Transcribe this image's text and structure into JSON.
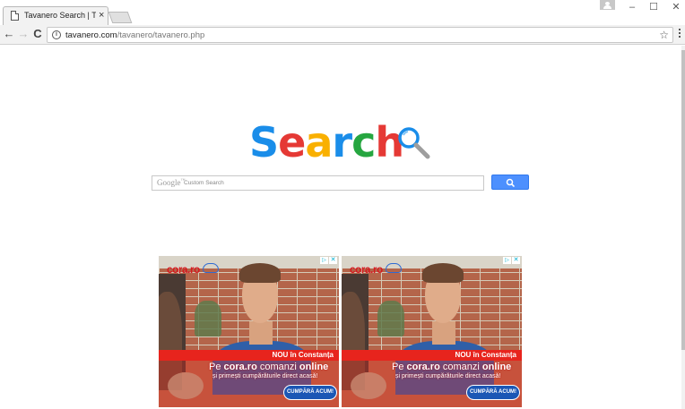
{
  "browser": {
    "tab_title": "Tavanero Search | Tavane",
    "tab_close": "×",
    "url_host": "tavanero.com",
    "url_path": "/tavanero/tavanero.php",
    "window_minimize": "–",
    "window_maximize": "☐",
    "window_close": "✕",
    "nav_back": "←",
    "nav_forward": "→",
    "nav_reload": "C",
    "info_glyph": "i",
    "star_glyph": "☆"
  },
  "logo": {
    "letters": [
      {
        "char": "S",
        "color": "#1a8de9"
      },
      {
        "char": "e",
        "color": "#e53935"
      },
      {
        "char": "a",
        "color": "#f9b000"
      },
      {
        "char": "r",
        "color": "#1a8de9"
      },
      {
        "char": "c",
        "color": "#26a640"
      },
      {
        "char": "h",
        "color": "#e53935"
      }
    ],
    "icon": "magnifier-icon"
  },
  "search": {
    "google_label": "Google",
    "google_tm": "™",
    "placeholder": "Custom Search",
    "button_icon": "search-icon"
  },
  "ads": [
    {
      "brand": "cora.ro",
      "nou_label": "NOU în Constanța",
      "headline_pre": "Pe ",
      "headline_brand": "cora.ro",
      "headline_mid": " comanzi ",
      "headline_em": "online",
      "sub": "și primești cumpărăturile direct acasă!",
      "cta": "CUMPĂRĂ ACUM!"
    },
    {
      "brand": "cora.ro",
      "nou_label": "NOU în Constanța",
      "headline_pre": "Pe ",
      "headline_brand": "cora.ro",
      "headline_mid": " comanzi ",
      "headline_em": "online",
      "sub": "și primești cumpărăturile direct acasă!",
      "cta": "CUMPĂRĂ ACUM!"
    }
  ],
  "colors": {
    "search_button": "#4d90fe",
    "ad_red": "#e7241d",
    "cta_blue": "#1b57b5"
  }
}
